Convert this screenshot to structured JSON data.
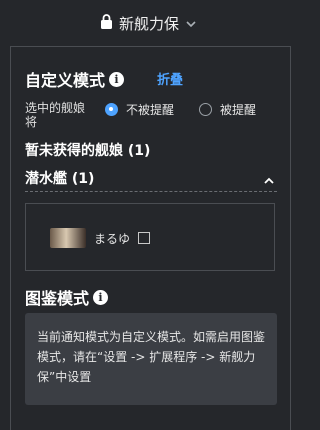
{
  "header": {
    "title": "新舰力保"
  },
  "custom_mode": {
    "title": "自定义模式",
    "collapse_link": "折叠",
    "selection_label": "选中的舰娘将",
    "option_not_remind": "不被提醒",
    "option_remind": "被提醒"
  },
  "unobtained": {
    "heading": "暂未获得的舰娘 (1)",
    "category": "潜水艦 (1)",
    "ship_name": "まるゆ"
  },
  "catalog_mode": {
    "title": "图鉴模式",
    "notice": "当前通知模式为自定义模式。如需启用图鉴模式，请在“设置 -> 扩展程序 -> 新舰力保”中设置"
  },
  "colors": {
    "background": "#25272b",
    "accent": "#4ea3ff",
    "notice_bg": "#3b3e44"
  }
}
